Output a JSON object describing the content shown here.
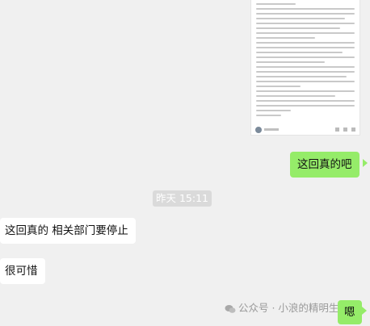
{
  "messages": {
    "right_1": "这回真的吧",
    "timestamp": "昨天 15:11",
    "left_1": "这回真的 相关部门要停止",
    "left_2": "很可惜",
    "right_2": "嗯"
  },
  "watermark": {
    "text": "公众号 · 小浪的精明生"
  },
  "colors": {
    "outgoing_bubble": "#95ec69",
    "incoming_bubble": "#ffffff",
    "background": "#f0f0f0"
  }
}
